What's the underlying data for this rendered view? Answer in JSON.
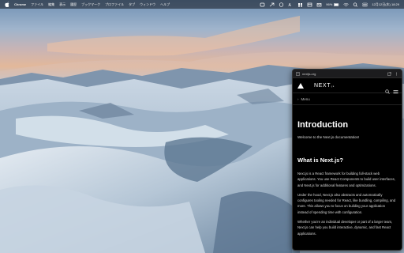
{
  "menubar": {
    "app": "Chrome",
    "items": [
      "ファイル",
      "編集",
      "表示",
      "履歴",
      "ブックマーク",
      "プロファイル",
      "タブ",
      "ウィンドウ",
      "ヘルプ"
    ],
    "battery": "96%",
    "datetime": "12月12日(木) 18:29"
  },
  "window": {
    "title": "nextjs.org"
  },
  "site": {
    "logo": "NEXT",
    "logo_suffix": ".js",
    "menu_label": "Menu",
    "heading": "Introduction",
    "welcome": "Welcome to the Next.js documentation!",
    "section_title": "What is Next.js?",
    "paragraphs": [
      "Next.js is a React framework for building full-stack web applications. You use React Components to build user interfaces, and Next.js for additional features and optimizations.",
      "Under the hood, Next.js also abstracts and automatically configures tooling needed for React, like bundling, compiling, and more. This allows you to focus on building your application instead of spending time with configuration.",
      "Whether you're an individual developer or part of a larger team, Next.js can help you build interactive, dynamic, and fast React applications."
    ]
  }
}
